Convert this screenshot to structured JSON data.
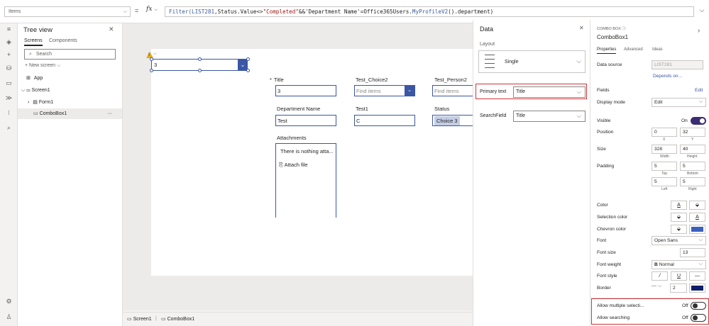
{
  "formula_bar": {
    "property": "Items",
    "equals": "=",
    "fx": "fx",
    "formula_parts": {
      "fn1": "Filter(",
      "ds": "LIST281",
      "mid1": ",Status.Value<>",
      "str": "\"Completed\"",
      "mid2": "&&'Department Name'=Office365Users.",
      "fn2": "MyProfileV2",
      "tail": "().department)"
    }
  },
  "tree": {
    "title": "Tree view",
    "tabs": [
      "Screens",
      "Components"
    ],
    "search_placeholder": "Search",
    "new_screen": "New screen",
    "items": [
      "App",
      "Screen1",
      "Form1",
      "ComboBox1"
    ],
    "ellipsis": "···"
  },
  "canvas": {
    "combo_value": "3",
    "fields": {
      "title_label": "Title",
      "title_value": "3",
      "choice_label": "Test_Choice2",
      "choice_placeholder": "Find items",
      "person_label": "Test_Person2",
      "person_placeholder": "Find items",
      "dept_label": "Department Name",
      "dept_value": "Test",
      "test1_label": "Test1",
      "test1_value": "C",
      "status_label": "Status",
      "status_value": "Choice 3",
      "attach_label": "Attachments",
      "attach_empty": "There is nothing atta...",
      "attach_file": "Attach file"
    }
  },
  "bottom_bar": {
    "screen": "Screen1",
    "control": "ComboBox1"
  },
  "data_pane": {
    "title": "Data",
    "layout_label": "Layout",
    "layout_value": "Single",
    "primary_text_label": "Primary text",
    "primary_text_value": "Title",
    "search_field_label": "SearchField",
    "search_field_value": "Title"
  },
  "props": {
    "type": "COMBO BOX",
    "name": "ComboBox1",
    "tabs": [
      "Properties",
      "Advanced",
      "Ideas"
    ],
    "data_source_label": "Data source",
    "data_source_value": "LIST281",
    "depends_on": "Depends on...",
    "fields_label": "Fields",
    "edit": "Edit",
    "display_mode_label": "Display mode",
    "display_mode_value": "Edit",
    "visible_label": "Visible",
    "visible_value": "On",
    "position_label": "Position",
    "pos_x": "0",
    "pos_y": "32",
    "x_label": "X",
    "y_label": "Y",
    "size_label": "Size",
    "width": "328",
    "height": "40",
    "width_label": "Width",
    "height_label": "Height",
    "padding_label": "Padding",
    "pad_top": "5",
    "pad_bottom": "5",
    "pad_left": "5",
    "pad_right": "5",
    "top_label": "Top",
    "bottom_label": "Bottom",
    "left_label": "Left",
    "right_label": "Right",
    "color_label": "Color",
    "selection_color_label": "Selection color",
    "chevron_color_label": "Chevron color",
    "font_label": "Font",
    "font_value": "Open Sans",
    "font_size_label": "Font size",
    "font_size_value": "13",
    "font_weight_label": "Font weight",
    "font_weight_value": "Normal",
    "font_style_label": "Font style",
    "border_label": "Border",
    "border_value": "2",
    "allow_multi_label": "Allow multiple selecti...",
    "allow_multi_value": "Off",
    "allow_search_label": "Allow searching",
    "allow_search_value": "Off",
    "chevron_fill": "#3b5fbf",
    "border_color": "#0d1f6b",
    "accent": "#3b2c74"
  }
}
